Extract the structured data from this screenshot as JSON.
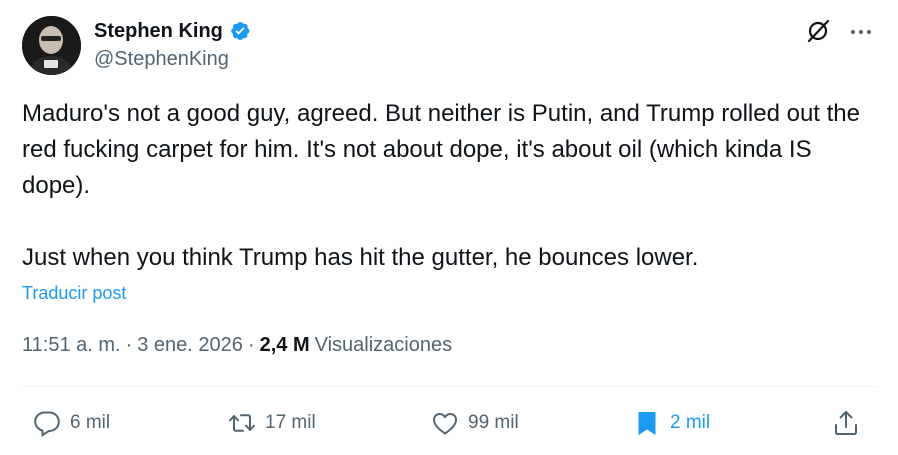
{
  "author": {
    "display_name": "Stephen King",
    "handle": "@StephenKing",
    "verified": true
  },
  "post": {
    "paragraphs": [
      "Maduro's not a good guy, agreed. But neither is Putin, and Trump rolled out the red fucking carpet for him. It's not about dope, it's about oil (which kinda IS dope).",
      "Just when you think Trump has hit the gutter, he bounces lower."
    ],
    "translate_label": "Traducir post"
  },
  "meta": {
    "time": "11:51 a. m.",
    "separator": "·",
    "date": "3 ene. 2026",
    "views_count": "2,4 M",
    "views_label": "Visualizaciones"
  },
  "actions": {
    "replies": "6 mil",
    "reposts": "17 mil",
    "likes": "99 mil",
    "bookmarks": "2 mil",
    "bookmarked": true
  },
  "colors": {
    "accent": "#1d9bf0",
    "text_primary": "#0f1419",
    "text_secondary": "#536471",
    "divider": "#eff3f4"
  },
  "icons": {
    "verified": "verified-badge-icon",
    "grok": "grok-icon",
    "more": "more-dots-icon",
    "reply": "reply-icon",
    "repost": "repost-icon",
    "like": "heart-icon",
    "bookmark": "bookmark-icon",
    "share": "share-icon"
  }
}
